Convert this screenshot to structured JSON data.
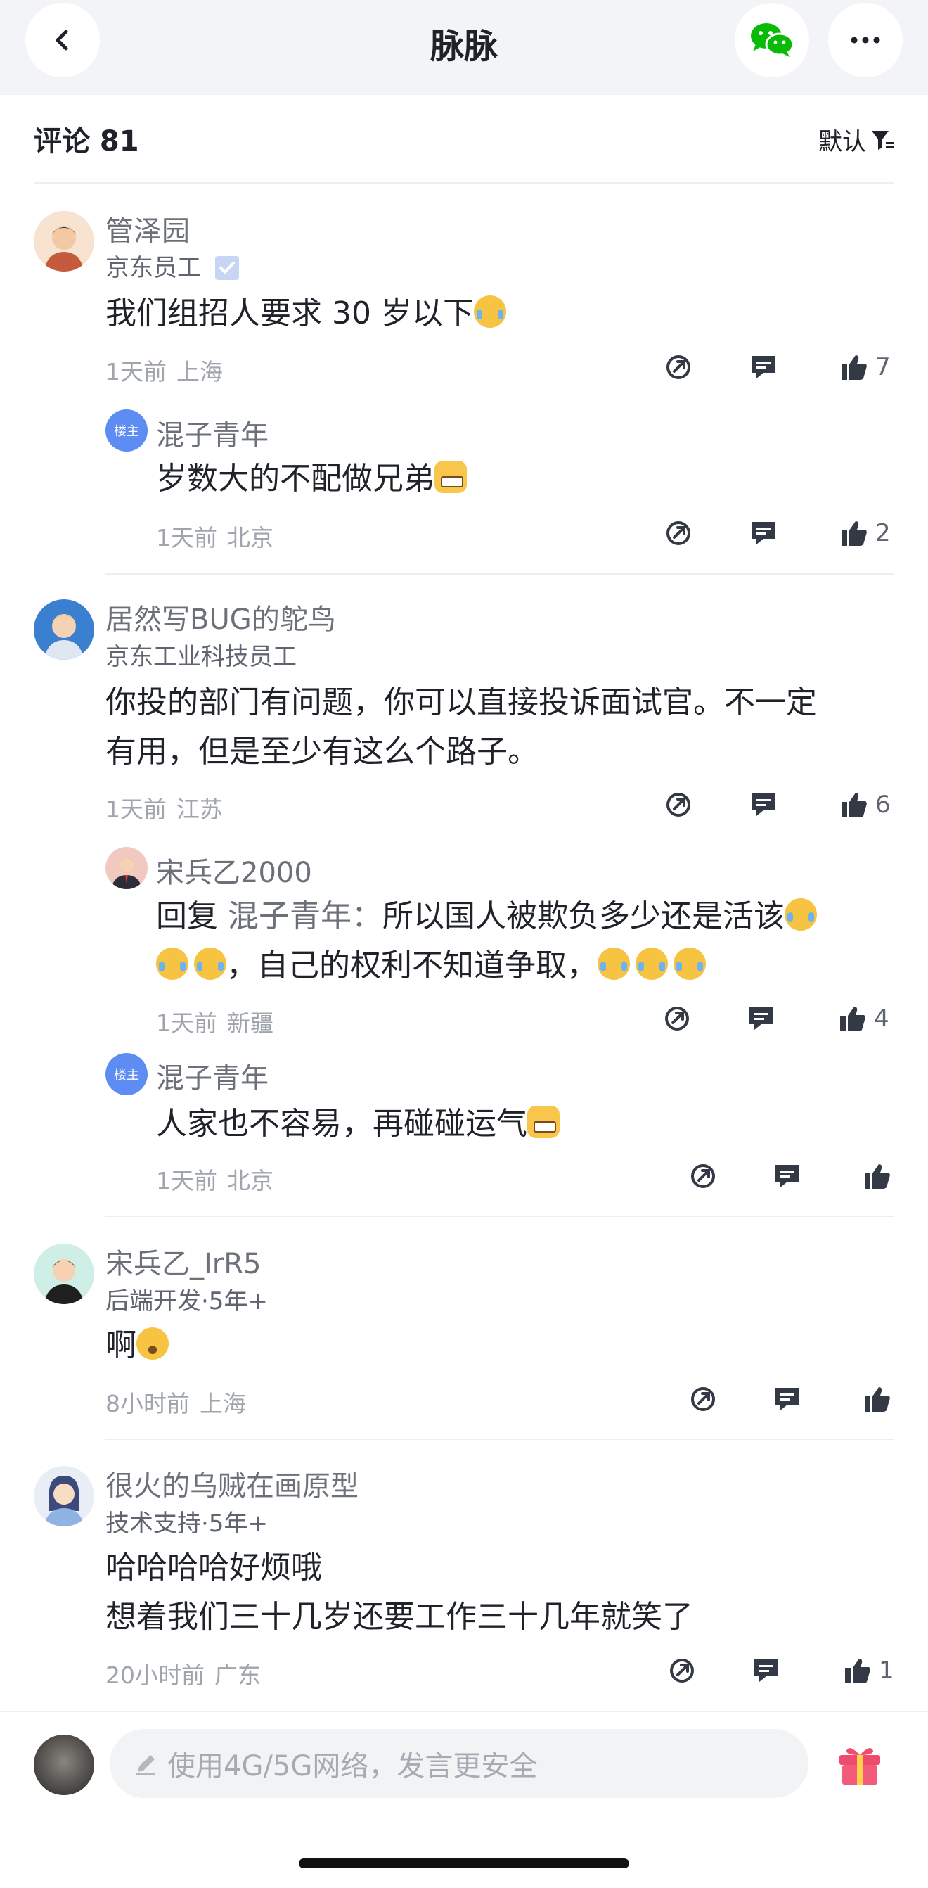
{
  "header": {
    "title": "脉脉"
  },
  "comments_bar": {
    "title": "评论 81",
    "sort": "默认"
  },
  "comments": [
    {
      "name": "管泽园",
      "subtitle": "京东员工",
      "content": "我们组招人要求 30 岁以下",
      "time": "1天前",
      "location": "上海",
      "likes": "7",
      "reply": {
        "badge": "楼主",
        "name": "混子青年",
        "content": "岁数大的不配做兄弟",
        "time": "1天前",
        "location": "北京",
        "likes": "2"
      }
    },
    {
      "name": "居然写BUG的鸵鸟",
      "subtitle": "京东工业科技员工",
      "content_line1": "你投的部门有问题，你可以直接投诉面试官。不一定",
      "content_line2": "有用，但是至少有这么个路子。",
      "time": "1天前",
      "location": "江苏",
      "likes": "6",
      "reply1": {
        "name": "宋兵乙2000",
        "prefix": "回复",
        "reply_to": "混子青年：",
        "line1": "所以国人被欺负多少还是活该",
        "line2": "，自己的权利不知道争取，",
        "time": "1天前",
        "location": "新疆",
        "likes": "4"
      },
      "reply2": {
        "badge": "楼主",
        "name": "混子青年",
        "content": "人家也不容易，再碰碰运气",
        "time": "1天前",
        "location": "北京"
      }
    },
    {
      "name": "宋兵乙_IrR5",
      "subtitle": "后端开发·5年+",
      "content": "啊",
      "time": "8小时前",
      "location": "上海"
    },
    {
      "name": "很火的乌贼在画原型",
      "subtitle": "技术支持·5年+",
      "content_line1": "哈哈哈哈好烦哦",
      "content_line2": "想着我们三十几岁还要工作三十几年就笑了",
      "time": "20小时前",
      "location": "广东",
      "likes": "1"
    }
  ],
  "input": {
    "placeholder": "使用4G/5G网络，发言更安全"
  },
  "icons": {
    "back": "chevron-left-icon",
    "wechat": "wechat-icon",
    "more": "more-dots-icon",
    "filter": "filter-icon",
    "verified": "verified-icon",
    "forward": "forward-icon",
    "comment": "comment-icon",
    "like": "thumbs-up-icon",
    "gift": "gift-icon",
    "pen": "pen-icon"
  },
  "colors": {
    "header_bg": "#f3f4f8",
    "accent": "#5d8cf3",
    "wechat": "#09bb07",
    "gift": "#f04a6c"
  }
}
